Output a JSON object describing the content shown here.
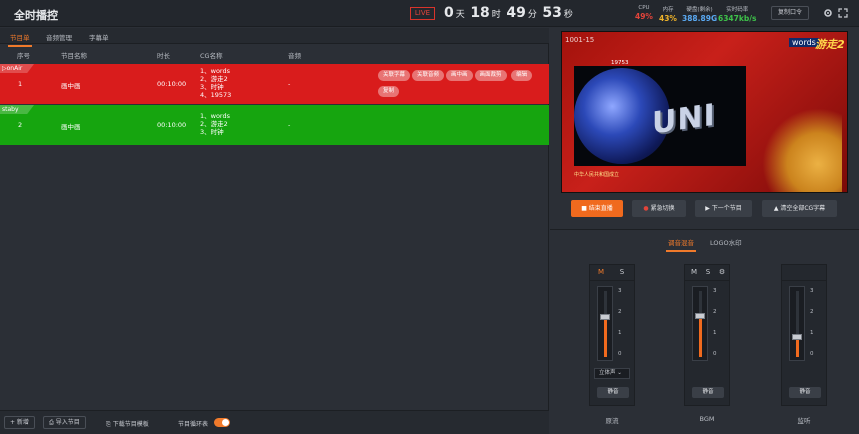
{
  "header": {
    "title": "全时播控",
    "live_badge": "LIVE",
    "timer": {
      "days": "0",
      "days_unit": "天",
      "hours": "18",
      "hours_unit": "时",
      "minutes": "49",
      "minutes_unit": "分",
      "seconds": "53",
      "seconds_unit": "秒"
    },
    "stats": [
      {
        "label": "CPU",
        "value": "49%",
        "color": "#e3443a"
      },
      {
        "label": "内存",
        "value": "43%",
        "color": "#f0b429"
      },
      {
        "label": "硬盘(剩余)",
        "value": "388.89G",
        "color": "#5aa9f2"
      },
      {
        "label": "实时码率",
        "value": "6347kb/s",
        "color": "#3ec24a"
      }
    ],
    "command_button": "复制口令",
    "icons": [
      "gear-icon",
      "fullscreen-icon"
    ]
  },
  "left_tabs": [
    {
      "label": "节目单",
      "active": true
    },
    {
      "label": "音频管理",
      "active": false
    },
    {
      "label": "字幕单",
      "active": false
    }
  ],
  "columns": [
    "序号",
    "节目名称",
    "时长",
    "CG名称",
    "音频"
  ],
  "rows": [
    {
      "status": "onAir",
      "index": "1",
      "name": "画中画",
      "duration": "00:10:00",
      "cg": [
        "1、words",
        "2、游走2",
        "3、时钟",
        "4、19573"
      ],
      "audio": "-",
      "actions": [
        "关联字幕",
        "关联音频",
        "画中画",
        "画面裁剪",
        "编辑",
        "复制"
      ]
    },
    {
      "status": "staby",
      "index": "2",
      "name": "画中画",
      "duration": "00:10:00",
      "cg": [
        "1、words",
        "2、游走2",
        "3、时钟"
      ],
      "audio": "-",
      "actions": []
    }
  ],
  "bottom": {
    "add": "+ 新增",
    "import": "导入节目",
    "download": "下载节目模板",
    "loop_label": "节目循环表",
    "loop_on": true
  },
  "preview": {
    "code": "1001-15",
    "words": "words",
    "brand": "游走2",
    "pip_number": "19753",
    "uni_text": "UNI",
    "bottom_text": "中华人民共和国成立"
  },
  "controls": {
    "end_live": "结束直播",
    "emergency": "紧急切换",
    "next": "下一个节目",
    "clear_cg": "清空全部CG字幕"
  },
  "mixer_tabs": [
    {
      "label": "调音混音",
      "active": true
    },
    {
      "label": "LOGO水印",
      "active": false
    }
  ],
  "strips": [
    {
      "label": "原流",
      "m": "M",
      "s": "S",
      "m_on": true,
      "level": 0.6,
      "select": "立体声",
      "mute": "静音",
      "ticks": [
        "3",
        "2",
        "1",
        "0"
      ]
    },
    {
      "label": "BGM",
      "m": "M",
      "s": "S",
      "m_on": false,
      "level": 0.62,
      "gear": true,
      "mute": "静音",
      "ticks": [
        "3",
        "2",
        "1",
        "0"
      ]
    },
    {
      "label": "监听",
      "m": "",
      "s": "",
      "m_on": false,
      "level": 0.3,
      "mute": "静音",
      "ticks": [
        "3",
        "2",
        "1",
        "0"
      ]
    }
  ]
}
